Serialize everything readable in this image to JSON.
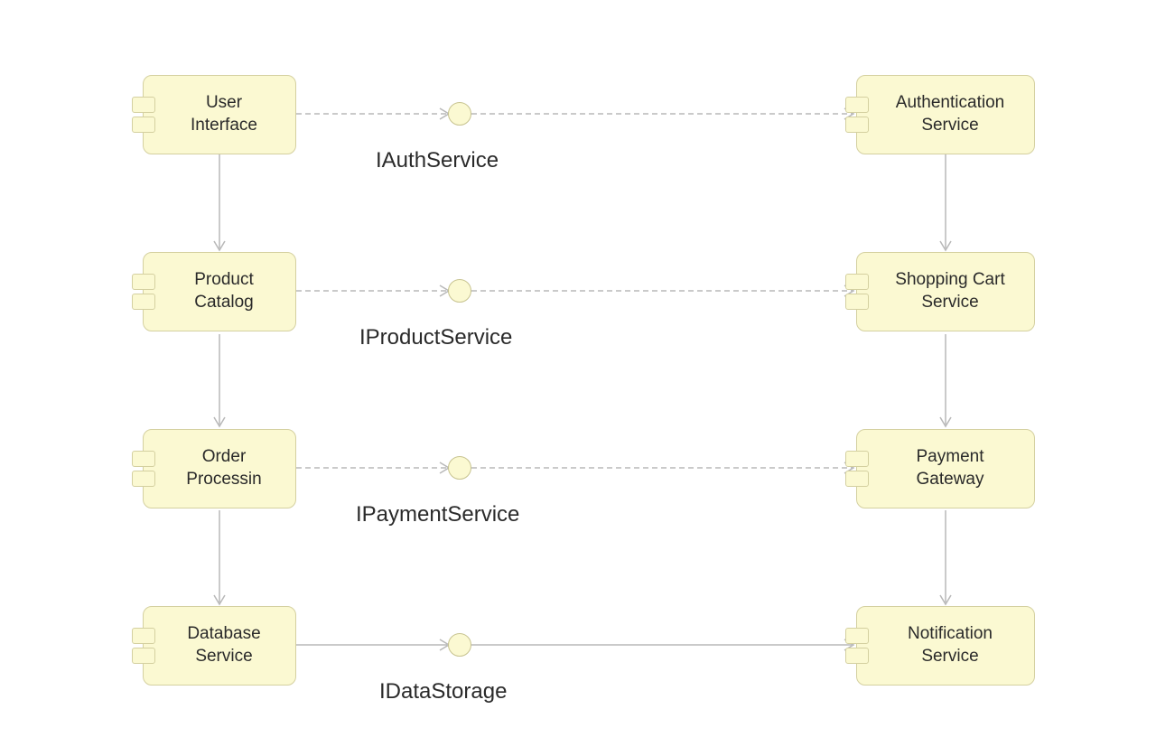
{
  "components": {
    "left": [
      {
        "label": "User Interface"
      },
      {
        "label": "Product Catalog"
      },
      {
        "label": "Order Processin"
      },
      {
        "label": "Database Service"
      }
    ],
    "right": [
      {
        "label": "Authentication Service"
      },
      {
        "label": "Shopping Cart Service"
      },
      {
        "label": "Payment Gateway"
      },
      {
        "label": "Notification Service"
      }
    ]
  },
  "interfaces": [
    {
      "label": "IAuthService"
    },
    {
      "label": "IProductService"
    },
    {
      "label": "IPaymentService"
    },
    {
      "label": "IDataStorage"
    }
  ],
  "colors": {
    "component_fill": "#fbf9d2",
    "component_border": "#d4d0a0",
    "line": "#b8b8b8"
  }
}
